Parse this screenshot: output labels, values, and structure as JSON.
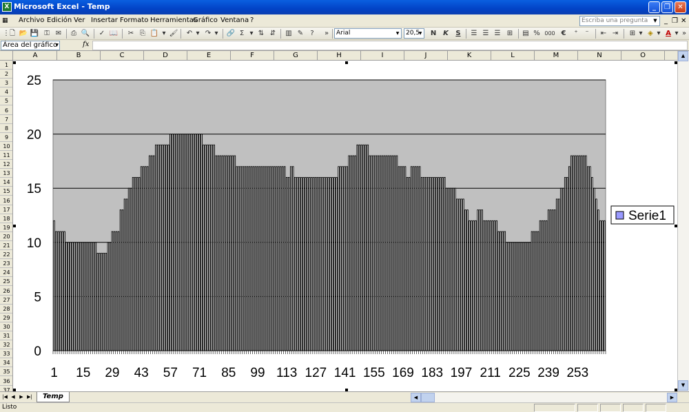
{
  "window": {
    "title": "Microsoft Excel - Temp",
    "minimize": "_",
    "restore": "❐",
    "close": "✕"
  },
  "menu": {
    "items": [
      "Archivo",
      "Edición",
      "Ver",
      "Insertar",
      "Formato",
      "Herramientas",
      "Gráfico",
      "Ventana",
      "?"
    ],
    "ask_placeholder": "Escriba una pregunta"
  },
  "toolbar": {
    "font_name": "Arial",
    "font_size": "20,5",
    "bold_label": "N",
    "italic_label": "K",
    "underline_label": "S",
    "percent_label": "%",
    "thousands_label": "000",
    "euro_label": "€",
    "font_color_label": "A"
  },
  "formula_bar": {
    "name_box": "Área del gráfico",
    "fx_label": "fx",
    "formula": ""
  },
  "grid": {
    "columns": [
      "A",
      "B",
      "C",
      "D",
      "E",
      "F",
      "G",
      "H",
      "I",
      "J",
      "K",
      "L",
      "M",
      "N",
      "O"
    ],
    "rows": [
      "1",
      "2",
      "3",
      "4",
      "5",
      "6",
      "7",
      "8",
      "9",
      "10",
      "11",
      "12",
      "13",
      "14",
      "15",
      "16",
      "17",
      "18",
      "19",
      "20",
      "21",
      "22",
      "23",
      "24",
      "25",
      "26",
      "27",
      "28",
      "29",
      "30",
      "31",
      "32",
      "33",
      "34",
      "35",
      "36",
      "37"
    ]
  },
  "sheet_tab": {
    "name": "Temp"
  },
  "status": {
    "text": "Listo"
  },
  "colors": {
    "plot_area": "#c0c0c0",
    "bar_fill": "#ffffff",
    "bar_stroke": "#000000",
    "legend_swatch": "#9999ff",
    "title_bar": "#0243c7"
  },
  "chart_data": {
    "type": "bar",
    "ylim": [
      0,
      25
    ],
    "yticks": [
      0,
      5,
      10,
      15,
      20,
      25
    ],
    "grid": true,
    "legend_position": "right",
    "x_tick_labels": [
      "1",
      "15",
      "29",
      "43",
      "57",
      "71",
      "85",
      "99",
      "113",
      "127",
      "141",
      "155",
      "169",
      "183",
      "197",
      "211",
      "225",
      "239",
      "253"
    ],
    "x_tick_values": [
      1,
      15,
      29,
      43,
      57,
      71,
      85,
      99,
      113,
      127,
      141,
      155,
      169,
      183,
      197,
      211,
      225,
      239,
      253
    ],
    "series": [
      {
        "name": "Serie1",
        "values": [
          12,
          11,
          11,
          11,
          11,
          11,
          10,
          10,
          10,
          10,
          10,
          10,
          10,
          10,
          10,
          10,
          10,
          10,
          10,
          10,
          10,
          9,
          9,
          9,
          9,
          9,
          10,
          10,
          11,
          11,
          11,
          11,
          13,
          13,
          14,
          14,
          15,
          15,
          16,
          16,
          16,
          16,
          17,
          17,
          17,
          17,
          18,
          18,
          18,
          19,
          19,
          19,
          19,
          19,
          19,
          19,
          20,
          20,
          20,
          20,
          20,
          20,
          20,
          20,
          20,
          20,
          20,
          20,
          20,
          20,
          20,
          20,
          19,
          19,
          19,
          19,
          19,
          19,
          18,
          18,
          18,
          18,
          18,
          18,
          18,
          18,
          18,
          18,
          17,
          17,
          17,
          17,
          17,
          17,
          17,
          17,
          17,
          17,
          17,
          17,
          17,
          17,
          17,
          17,
          17,
          17,
          17,
          17,
          17,
          17,
          17,
          17,
          16,
          16,
          17,
          17,
          16,
          16,
          16,
          16,
          16,
          16,
          16,
          16,
          16,
          16,
          16,
          16,
          16,
          16,
          16,
          16,
          16,
          16,
          16,
          16,
          16,
          17,
          17,
          17,
          17,
          17,
          18,
          18,
          18,
          18,
          19,
          19,
          19,
          19,
          19,
          19,
          18,
          18,
          18,
          18,
          18,
          18,
          18,
          18,
          18,
          18,
          18,
          18,
          18,
          18,
          17,
          17,
          17,
          17,
          16,
          16,
          17,
          17,
          17,
          17,
          17,
          16,
          16,
          16,
          16,
          16,
          16,
          16,
          16,
          16,
          16,
          16,
          16,
          15,
          15,
          15,
          15,
          15,
          14,
          14,
          14,
          14,
          13,
          13,
          12,
          12,
          12,
          12,
          13,
          13,
          13,
          12,
          12,
          12,
          12,
          12,
          12,
          12,
          11,
          11,
          11,
          11,
          10,
          10,
          10,
          10,
          10,
          10,
          10,
          10,
          10,
          10,
          10,
          10,
          11,
          11,
          11,
          11,
          12,
          12,
          12,
          12,
          13,
          13,
          13,
          13,
          14,
          14,
          15,
          15,
          16,
          16,
          17,
          18,
          18,
          18,
          18,
          18,
          18,
          18,
          18,
          17,
          17,
          16,
          15,
          14,
          13,
          12,
          12,
          12
        ]
      }
    ]
  }
}
